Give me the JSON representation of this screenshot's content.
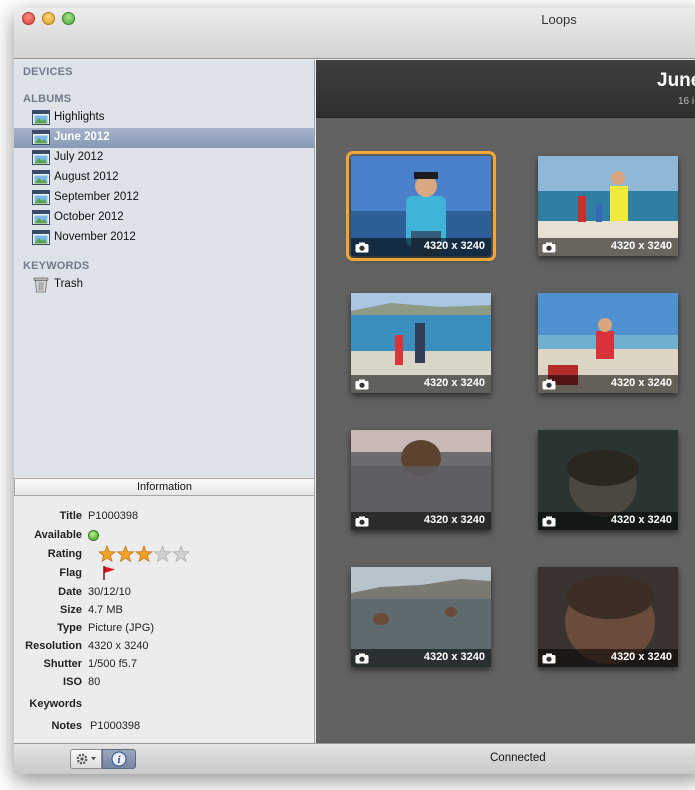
{
  "window": {
    "title": "Loops"
  },
  "sidebar": {
    "devices_header": "DEVICES",
    "albums_header": "ALBUMS",
    "keywords_header": "KEYWORDS",
    "albums": [
      {
        "label": "Highlights"
      },
      {
        "label": "June 2012"
      },
      {
        "label": "July 2012"
      },
      {
        "label": "August 2012"
      },
      {
        "label": "September 2012"
      },
      {
        "label": "October 2012"
      },
      {
        "label": "November 2012"
      }
    ],
    "keywords": [
      {
        "label": "Trash"
      }
    ]
  },
  "info": {
    "tab_label": "Information",
    "title_label": "Title",
    "title": "P1000398",
    "available_label": "Available",
    "rating_label": "Rating",
    "rating_stars": 3,
    "rating_max": 5,
    "flag_label": "Flag",
    "date_label": "Date",
    "date": "30/12/10",
    "size_label": "Size",
    "size": "4.7 MB",
    "type_label": "Type",
    "type": "Picture (JPG)",
    "resolution_label": "Resolution",
    "resolution": "4320 x 3240",
    "shutter_label": "Shutter",
    "shutter": "1/500 f5.7",
    "iso_label": "ISO",
    "iso": "80",
    "keywords_label": "Keywords",
    "notes_label": "Notes",
    "notes": "P1000398"
  },
  "main": {
    "title": "June",
    "subtitle": "16 i",
    "thumbs": [
      {
        "dims": "4320 x 3240"
      },
      {
        "dims": "4320 x 3240"
      },
      {
        "dims": "4320 x 3240"
      },
      {
        "dims": "4320 x 3240"
      },
      {
        "dims": "4320 x 3240"
      },
      {
        "dims": "4320 x 3240"
      },
      {
        "dims": "4320 x 3240"
      },
      {
        "dims": "4320 x 3240"
      }
    ]
  },
  "status": {
    "text": "Connected"
  },
  "colors": {
    "selection_outline": "#f1a636",
    "sidebar_bg": "#dee3ea",
    "content_bg": "#626262"
  }
}
